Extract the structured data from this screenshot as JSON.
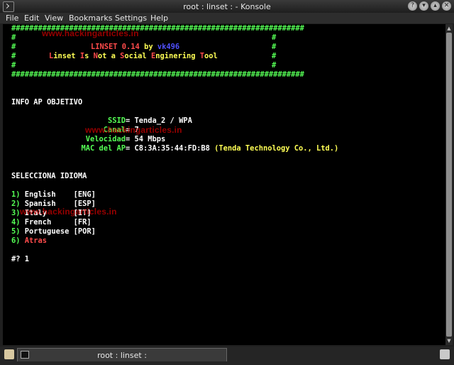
{
  "window": {
    "title": "root : linset : - Konsole"
  },
  "menu": [
    "File",
    "Edit",
    "View",
    "Bookmarks",
    "Settings",
    "Help"
  ],
  "terminal": {
    "banner_border": "##################################################################",
    "banner_title_left": "LINSET 0.14",
    "banner_title_by": " by ",
    "banner_title_author": "vk496",
    "banner_subtitle": [
      {
        "c": "red",
        "t": "L"
      },
      {
        "c": "yellow",
        "t": "inset "
      },
      {
        "c": "red",
        "t": "I"
      },
      {
        "c": "yellow",
        "t": "s "
      },
      {
        "c": "red",
        "t": "N"
      },
      {
        "c": "yellow",
        "t": "ot a "
      },
      {
        "c": "red",
        "t": "S"
      },
      {
        "c": "yellow",
        "t": "ocial "
      },
      {
        "c": "red",
        "t": "E"
      },
      {
        "c": "yellow",
        "t": "nginering "
      },
      {
        "c": "red",
        "t": "T"
      },
      {
        "c": "yellow",
        "t": "ool"
      }
    ],
    "info_heading": "INFO AP OBJETIVO",
    "ap": {
      "ssid_label": "SSID",
      "ssid_value": "Tenda_2 / WPA",
      "canal_label": "Canal",
      "canal_value": "7",
      "velocidad_label": "Velocidad",
      "velocidad_value": "54 Mbps",
      "mac_label": "MAC del AP",
      "mac_value": "C8:3A:35:44:FD:B8",
      "vendor": "(Tenda Technology Co., Ltd.)"
    },
    "lang_heading": "SELECCIONA IDIOMA",
    "languages": [
      {
        "num": "1)",
        "name": "English   ",
        "code": "[ENG]"
      },
      {
        "num": "2)",
        "name": "Spanish   ",
        "code": "[ESP]"
      },
      {
        "num": "3)",
        "name": "Italy     ",
        "code": "[IT]"
      },
      {
        "num": "4)",
        "name": "French    ",
        "code": "[FR]"
      },
      {
        "num": "5)",
        "name": "Portuguese",
        "code": "[POR]"
      }
    ],
    "back_option": {
      "num": "6)",
      "name": "Atras"
    },
    "prompt": "#? 1"
  },
  "watermark": "www.hackingarticles.in",
  "tab": {
    "label": "root : linset :"
  },
  "colors": {
    "green": "#55ff55",
    "red": "#ff4b4b",
    "yellow": "#ffff55",
    "blue": "#5050ff",
    "background": "#000000"
  }
}
